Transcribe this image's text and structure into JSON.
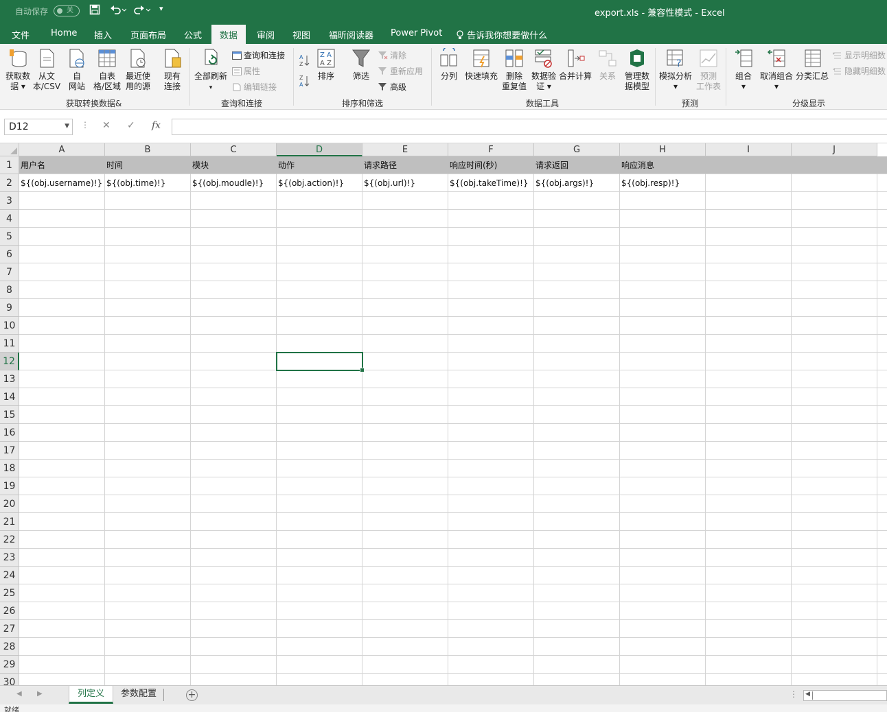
{
  "titlebar": {
    "autosave_label": "自动保存",
    "autosave_state": "关",
    "title": "export.xls  -  兼容性模式  -  Excel"
  },
  "menu": {
    "tabs": [
      "文件",
      "Home",
      "插入",
      "页面布局",
      "公式",
      "数据",
      "审阅",
      "视图",
      "福昕阅读器",
      "Power Pivot"
    ],
    "active_tab": "数据",
    "tell_me": "告诉我你想要做什么"
  },
  "ribbon": {
    "get_data": {
      "group_label": "获取转换数据&",
      "buttons": [
        {
          "label": "获取数\n据 ▾"
        },
        {
          "label": "从文\n本/CSV"
        },
        {
          "label": "自\n网站"
        },
        {
          "label": "自表\n格/区域"
        },
        {
          "label": "最近使\n用的源"
        },
        {
          "label": "现有\n连接"
        }
      ]
    },
    "queries": {
      "group_label": "查询和连接",
      "refresh_all": "全部刷新",
      "queries_connections": "查询和连接",
      "properties": "属性",
      "edit_links": "编辑链接"
    },
    "sort_filter": {
      "group_label": "排序和筛选",
      "sort": "排序",
      "filter": "筛选",
      "clear": "清除",
      "reapply": "重新应用",
      "advanced": "高级"
    },
    "data_tools": {
      "group_label": "数据工具",
      "text_to_columns": "分列",
      "flash_fill": "快速填充",
      "remove_duplicates": "删除\n重复值",
      "data_validation": "数据验\n证 ▾",
      "consolidate": "合并计算",
      "relationships": "关系",
      "manage_data_model": "管理数\n据模型"
    },
    "forecast": {
      "group_label": "预测",
      "what_if": "模拟分析\n▾",
      "forecast_sheet": "预测\n工作表"
    },
    "outline": {
      "group_label": "分级显示",
      "group": "组合\n▾",
      "ungroup": "取消组合\n▾",
      "subtotal": "分类汇总",
      "show_detail": "显示明细数",
      "hide_detail": "隐藏明细数"
    }
  },
  "formula_bar": {
    "name_box": "D12",
    "formula": ""
  },
  "sheet": {
    "columns": [
      "A",
      "B",
      "C",
      "D",
      "E",
      "F",
      "G",
      "H",
      "I",
      "J"
    ],
    "selected_column": "D",
    "selected_row": 12,
    "row_count": 30,
    "header_row": [
      "用户名",
      "时间",
      "模块",
      "动作",
      "请求路径",
      "响应时间(秒)",
      "请求返回",
      "响应消息"
    ],
    "template_row": [
      "${(obj.username)!}",
      "${(obj.time)!}",
      "${(obj.moudle)!}",
      "${(obj.action)!}",
      "${(obj.url)!}",
      "${(obj.takeTime)!}",
      "${(obj.args)!}",
      "${(obj.resp)!}"
    ]
  },
  "sheet_tabs": {
    "tabs": [
      "列定义",
      "参数配置"
    ],
    "active": "列定义"
  },
  "status": {
    "text": "就绪"
  }
}
